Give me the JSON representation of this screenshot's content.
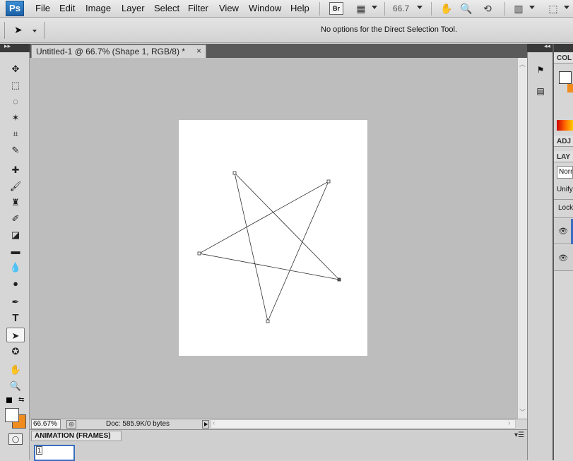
{
  "menubar": {
    "logo": "Ps",
    "items": [
      "File",
      "Edit",
      "Image",
      "Layer",
      "Select",
      "Filter",
      "View",
      "Window",
      "Help"
    ],
    "bridge_label": "Br",
    "zoom": "66.7"
  },
  "options_bar": {
    "message": "No options for the Direct Selection Tool."
  },
  "document": {
    "tab_title": "Untitled-1 @ 66.7% (Shape 1, RGB/8) *",
    "close": "×"
  },
  "status_bar": {
    "zoom": "66.67%",
    "doc_size": "Doc: 585.9K/0 bytes"
  },
  "animation_panel": {
    "title": "ANIMATION (FRAMES)",
    "frame_number": "1"
  },
  "right_panels": {
    "color_label": "COL",
    "adjust_label": "ADJ",
    "layers_label": "LAY",
    "blend_mode": "Norn",
    "unify_label": "Unify",
    "lock_label": "Lock"
  },
  "tools": [
    "move-tool",
    "marquee-tool",
    "lasso-tool",
    "magic-wand-tool",
    "crop-tool",
    "eyedropper-tool",
    "healing-brush-tool",
    "brush-tool",
    "clone-stamp-tool",
    "history-brush-tool",
    "eraser-tool",
    "gradient-tool",
    "blur-tool",
    "dodge-tool",
    "pen-tool",
    "type-tool",
    "direct-selection-tool",
    "custom-shape-tool",
    "hand-tool",
    "zoom-tool"
  ],
  "colors": {
    "foreground": "#ffffff",
    "background": "#f08c1e",
    "canvas_bg": "#bdbdbd"
  }
}
